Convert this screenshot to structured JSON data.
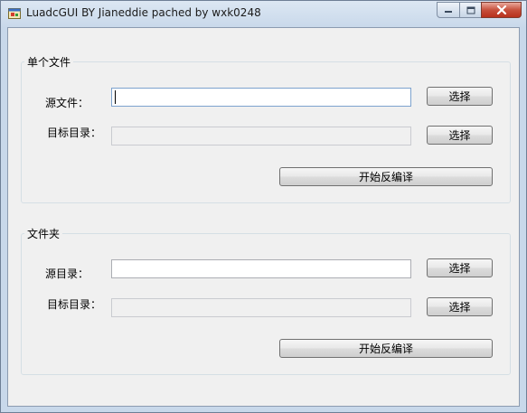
{
  "window": {
    "title": "LuadcGUI BY Jianeddie pached by wxk0248"
  },
  "single_file": {
    "group_title": "单个文件",
    "source_label": "源文件：",
    "source_value": "",
    "target_label": "目标目录：",
    "target_value": "",
    "browse_source_label": "选择",
    "browse_target_label": "选择",
    "start_label": "开始反编译"
  },
  "folder": {
    "group_title": "文件夹",
    "source_label": "源目录：",
    "source_value": "",
    "target_label": "目标目录：",
    "target_value": "",
    "browse_source_label": "选择",
    "browse_target_label": "选择",
    "start_label": "开始反编译"
  },
  "icons": {
    "app": "app-window-icon",
    "minimize": "minimize-icon",
    "maximize": "maximize-icon",
    "close": "close-icon"
  }
}
